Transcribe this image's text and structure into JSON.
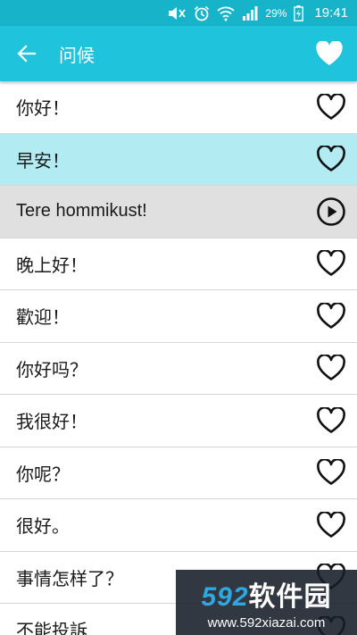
{
  "status": {
    "battery_pct": "29%",
    "time": "19:41",
    "icons": [
      "mute-icon",
      "alarm-icon",
      "wifi-icon",
      "signal-icon",
      "battery-icon"
    ]
  },
  "appbar": {
    "title": "问候",
    "back_icon": "arrow-left-icon",
    "favorite_icon": "heart-filled-icon"
  },
  "phrases": [
    {
      "text": "你好！",
      "icon": "heart-outline-icon",
      "state": "normal"
    },
    {
      "text": "早安！",
      "icon": "heart-outline-icon",
      "state": "selected"
    },
    {
      "text": "Tere hommikust!",
      "icon": "play-icon",
      "state": "translation"
    },
    {
      "text": "晚上好！",
      "icon": "heart-outline-icon",
      "state": "normal"
    },
    {
      "text": "歡迎！",
      "icon": "heart-outline-icon",
      "state": "normal"
    },
    {
      "text": "你好吗？",
      "icon": "heart-outline-icon",
      "state": "normal"
    },
    {
      "text": "我很好！",
      "icon": "heart-outline-icon",
      "state": "normal"
    },
    {
      "text": "你呢？",
      "icon": "heart-outline-icon",
      "state": "normal"
    },
    {
      "text": "很好。",
      "icon": "heart-outline-icon",
      "state": "normal"
    },
    {
      "text": "事情怎样了？",
      "icon": "heart-outline-icon",
      "state": "normal"
    },
    {
      "text": "不能投訴",
      "icon": "heart-outline-icon",
      "state": "normal"
    }
  ],
  "watermark": {
    "brand_num": "592",
    "brand_cn": "软件园",
    "url": "www.592xiazai.com"
  },
  "colors": {
    "statusbar": "#17b3c9",
    "appbar": "#1fc3dc",
    "selected_row": "#b2ebf2",
    "translation_row": "#e0e0e0"
  }
}
